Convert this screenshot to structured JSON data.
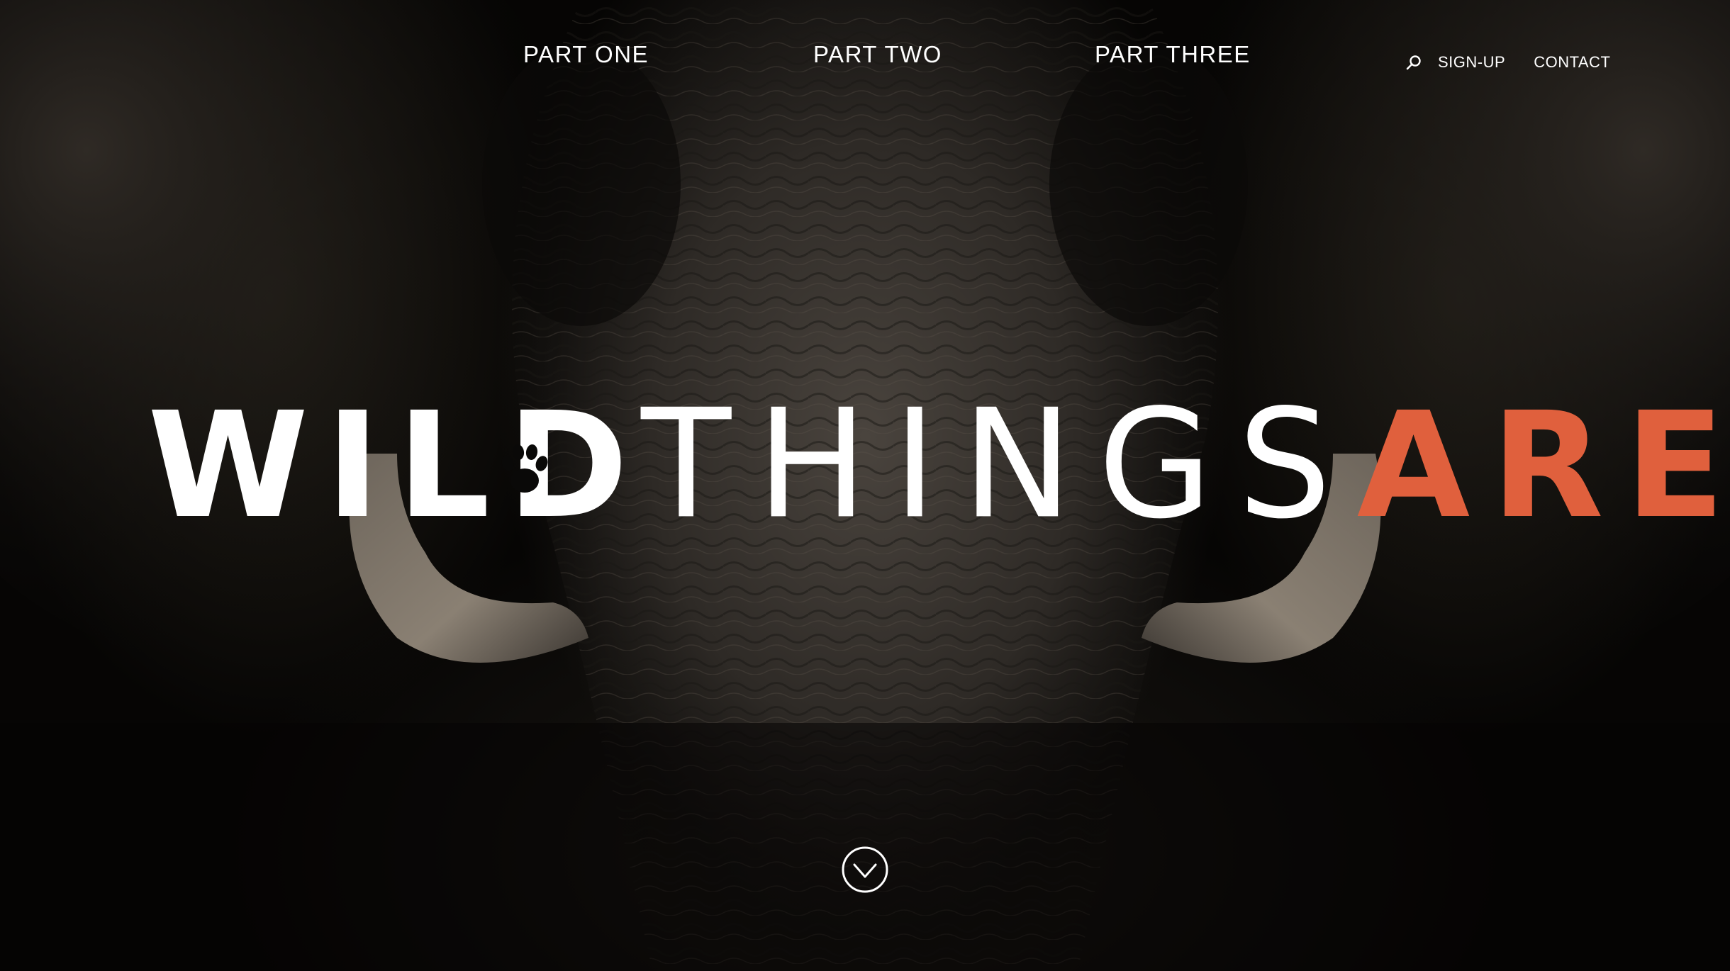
{
  "nav": {
    "items": [
      {
        "label": "PART ONE"
      },
      {
        "label": "PART TWO"
      },
      {
        "label": "PART THREE"
      }
    ]
  },
  "utility_nav": {
    "search_icon": "search-icon",
    "signup_label": "SIGN-UP",
    "contact_label": "CONTACT"
  },
  "hero": {
    "title_part1": "WILD",
    "title_part2": "THINGS",
    "title_part3": "ARE",
    "title_accent_color": "#e0603d",
    "title_color": "#ffffff",
    "paw_icon": "paw-print-icon",
    "scroll_icon": "chevron-down-circle-icon"
  }
}
